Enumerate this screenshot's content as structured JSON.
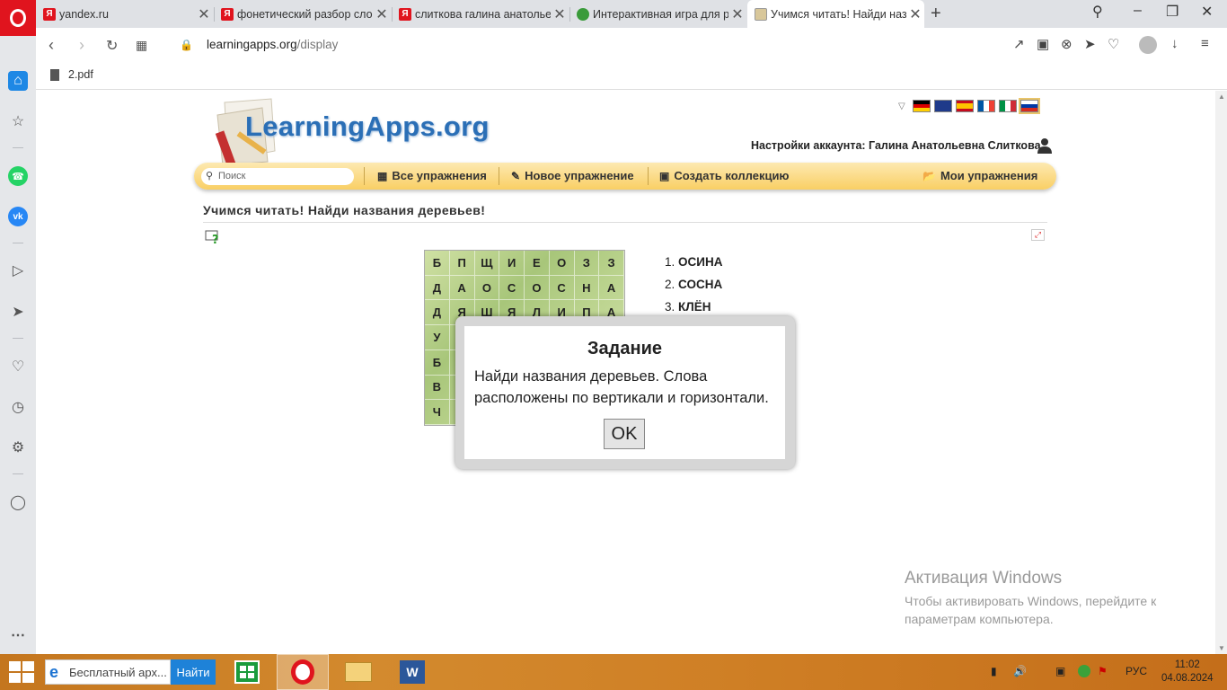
{
  "browser": {
    "tabs": [
      {
        "title": "yandex.ru",
        "favicon": "yandex-icon"
      },
      {
        "title": "фонетический разбор сло",
        "favicon": "yandex-icon"
      },
      {
        "title": "слиткова галина анатолье",
        "favicon": "yandex-icon"
      },
      {
        "title": "Интерактивная игра для р",
        "favicon": "globe-icon"
      },
      {
        "title": "Учимся читать! Найди наз",
        "favicon": "learningapps-icon",
        "active": true
      }
    ],
    "url_host": "learningapps.org",
    "url_path": "/display",
    "bookmark": "2.pdf"
  },
  "site": {
    "logo": "LearningApps.org",
    "account": "Настройки аккаунта: Галина Анатольевна Слиткова",
    "search_placeholder": "Поиск",
    "nav": {
      "all": "Все упражнения",
      "new": "Новое упражнение",
      "collection": "Создать коллекцию",
      "mine": "Мои упражнения"
    },
    "languages": [
      "de",
      "en",
      "es",
      "fr",
      "it",
      "ru"
    ]
  },
  "exercise": {
    "title": "Учимся читать! Найди названия деревьев!",
    "grid": [
      [
        "Б",
        "П",
        "Щ",
        "И",
        "Е",
        "О",
        "З",
        "З"
      ],
      [
        "Д",
        "А",
        "О",
        "С",
        "О",
        "С",
        "Н",
        "А"
      ],
      [
        "Д",
        "Я",
        "Ш",
        "Я",
        "Л",
        "И",
        "П",
        "А"
      ],
      [
        "У",
        "",
        "",
        "",
        "",
        "",
        "",
        ""
      ],
      [
        "Б",
        "",
        "",
        "",
        "",
        "",
        "",
        ""
      ],
      [
        "В",
        "",
        "",
        "",
        "",
        "",
        "",
        ""
      ],
      [
        "Ч",
        "",
        "",
        "",
        "",
        "",
        "",
        ""
      ]
    ],
    "words": [
      {
        "num": "1.",
        "text": "ОСИНА"
      },
      {
        "num": "2.",
        "text": "СОСНА"
      },
      {
        "num": "3.",
        "text": "КЛЁН"
      }
    ]
  },
  "modal": {
    "title": "Задание",
    "text": "Найди названия деревьев. Слова расположены по вертикали и горизонтали.",
    "ok": "OK"
  },
  "activation": {
    "title": "Активация Windows",
    "subtitle": "Чтобы активировать Windows, перейдите к параметрам компьютера."
  },
  "taskbar": {
    "search_text": "Бесплатный арх...",
    "search_button": "Найти",
    "lang": "РУС",
    "time": "11:02",
    "date": "04.08.2024"
  },
  "colors": {
    "opera_red": "#e0141e",
    "navbar_yellow": "#f9cf64",
    "logo_blue": "#2b6fb6",
    "taskbar_orange": "#cf7f25"
  }
}
